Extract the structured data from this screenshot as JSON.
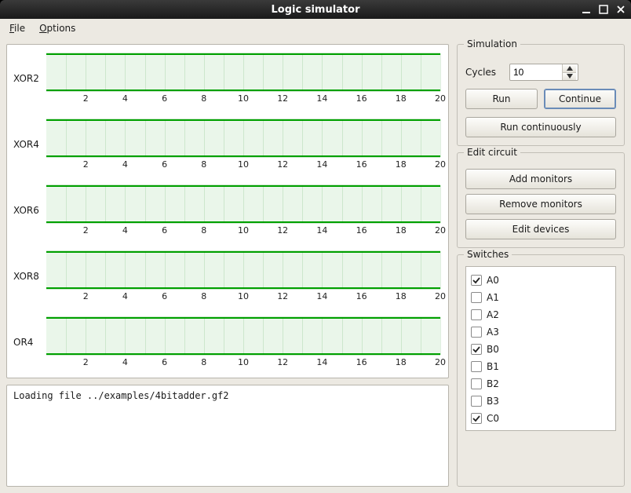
{
  "window": {
    "title": "Logic simulator"
  },
  "menu": {
    "file": "File",
    "options": "Options"
  },
  "waveform": {
    "signals": [
      "XOR2",
      "XOR4",
      "XOR6",
      "XOR8",
      "OR4"
    ],
    "ticks": [
      2,
      4,
      6,
      8,
      10,
      12,
      14,
      16,
      18,
      20
    ],
    "range": 20,
    "grid_divisions": 20
  },
  "log": {
    "text": "Loading file ../examples/4bitadder.gf2"
  },
  "simulation": {
    "title": "Simulation",
    "cycles_label": "Cycles",
    "cycles_value": "10",
    "run_label": "Run",
    "continue_label": "Continue",
    "run_cont_label": "Run continuously"
  },
  "edit_circuit": {
    "title": "Edit circuit",
    "add_monitors": "Add monitors",
    "remove_monitors": "Remove monitors",
    "edit_devices": "Edit devices"
  },
  "switches": {
    "title": "Switches",
    "items": [
      {
        "name": "A0",
        "checked": true
      },
      {
        "name": "A1",
        "checked": false
      },
      {
        "name": "A2",
        "checked": false
      },
      {
        "name": "A3",
        "checked": false
      },
      {
        "name": "B0",
        "checked": true
      },
      {
        "name": "B1",
        "checked": false
      },
      {
        "name": "B2",
        "checked": false
      },
      {
        "name": "B3",
        "checked": false
      },
      {
        "name": "C0",
        "checked": true
      }
    ]
  }
}
